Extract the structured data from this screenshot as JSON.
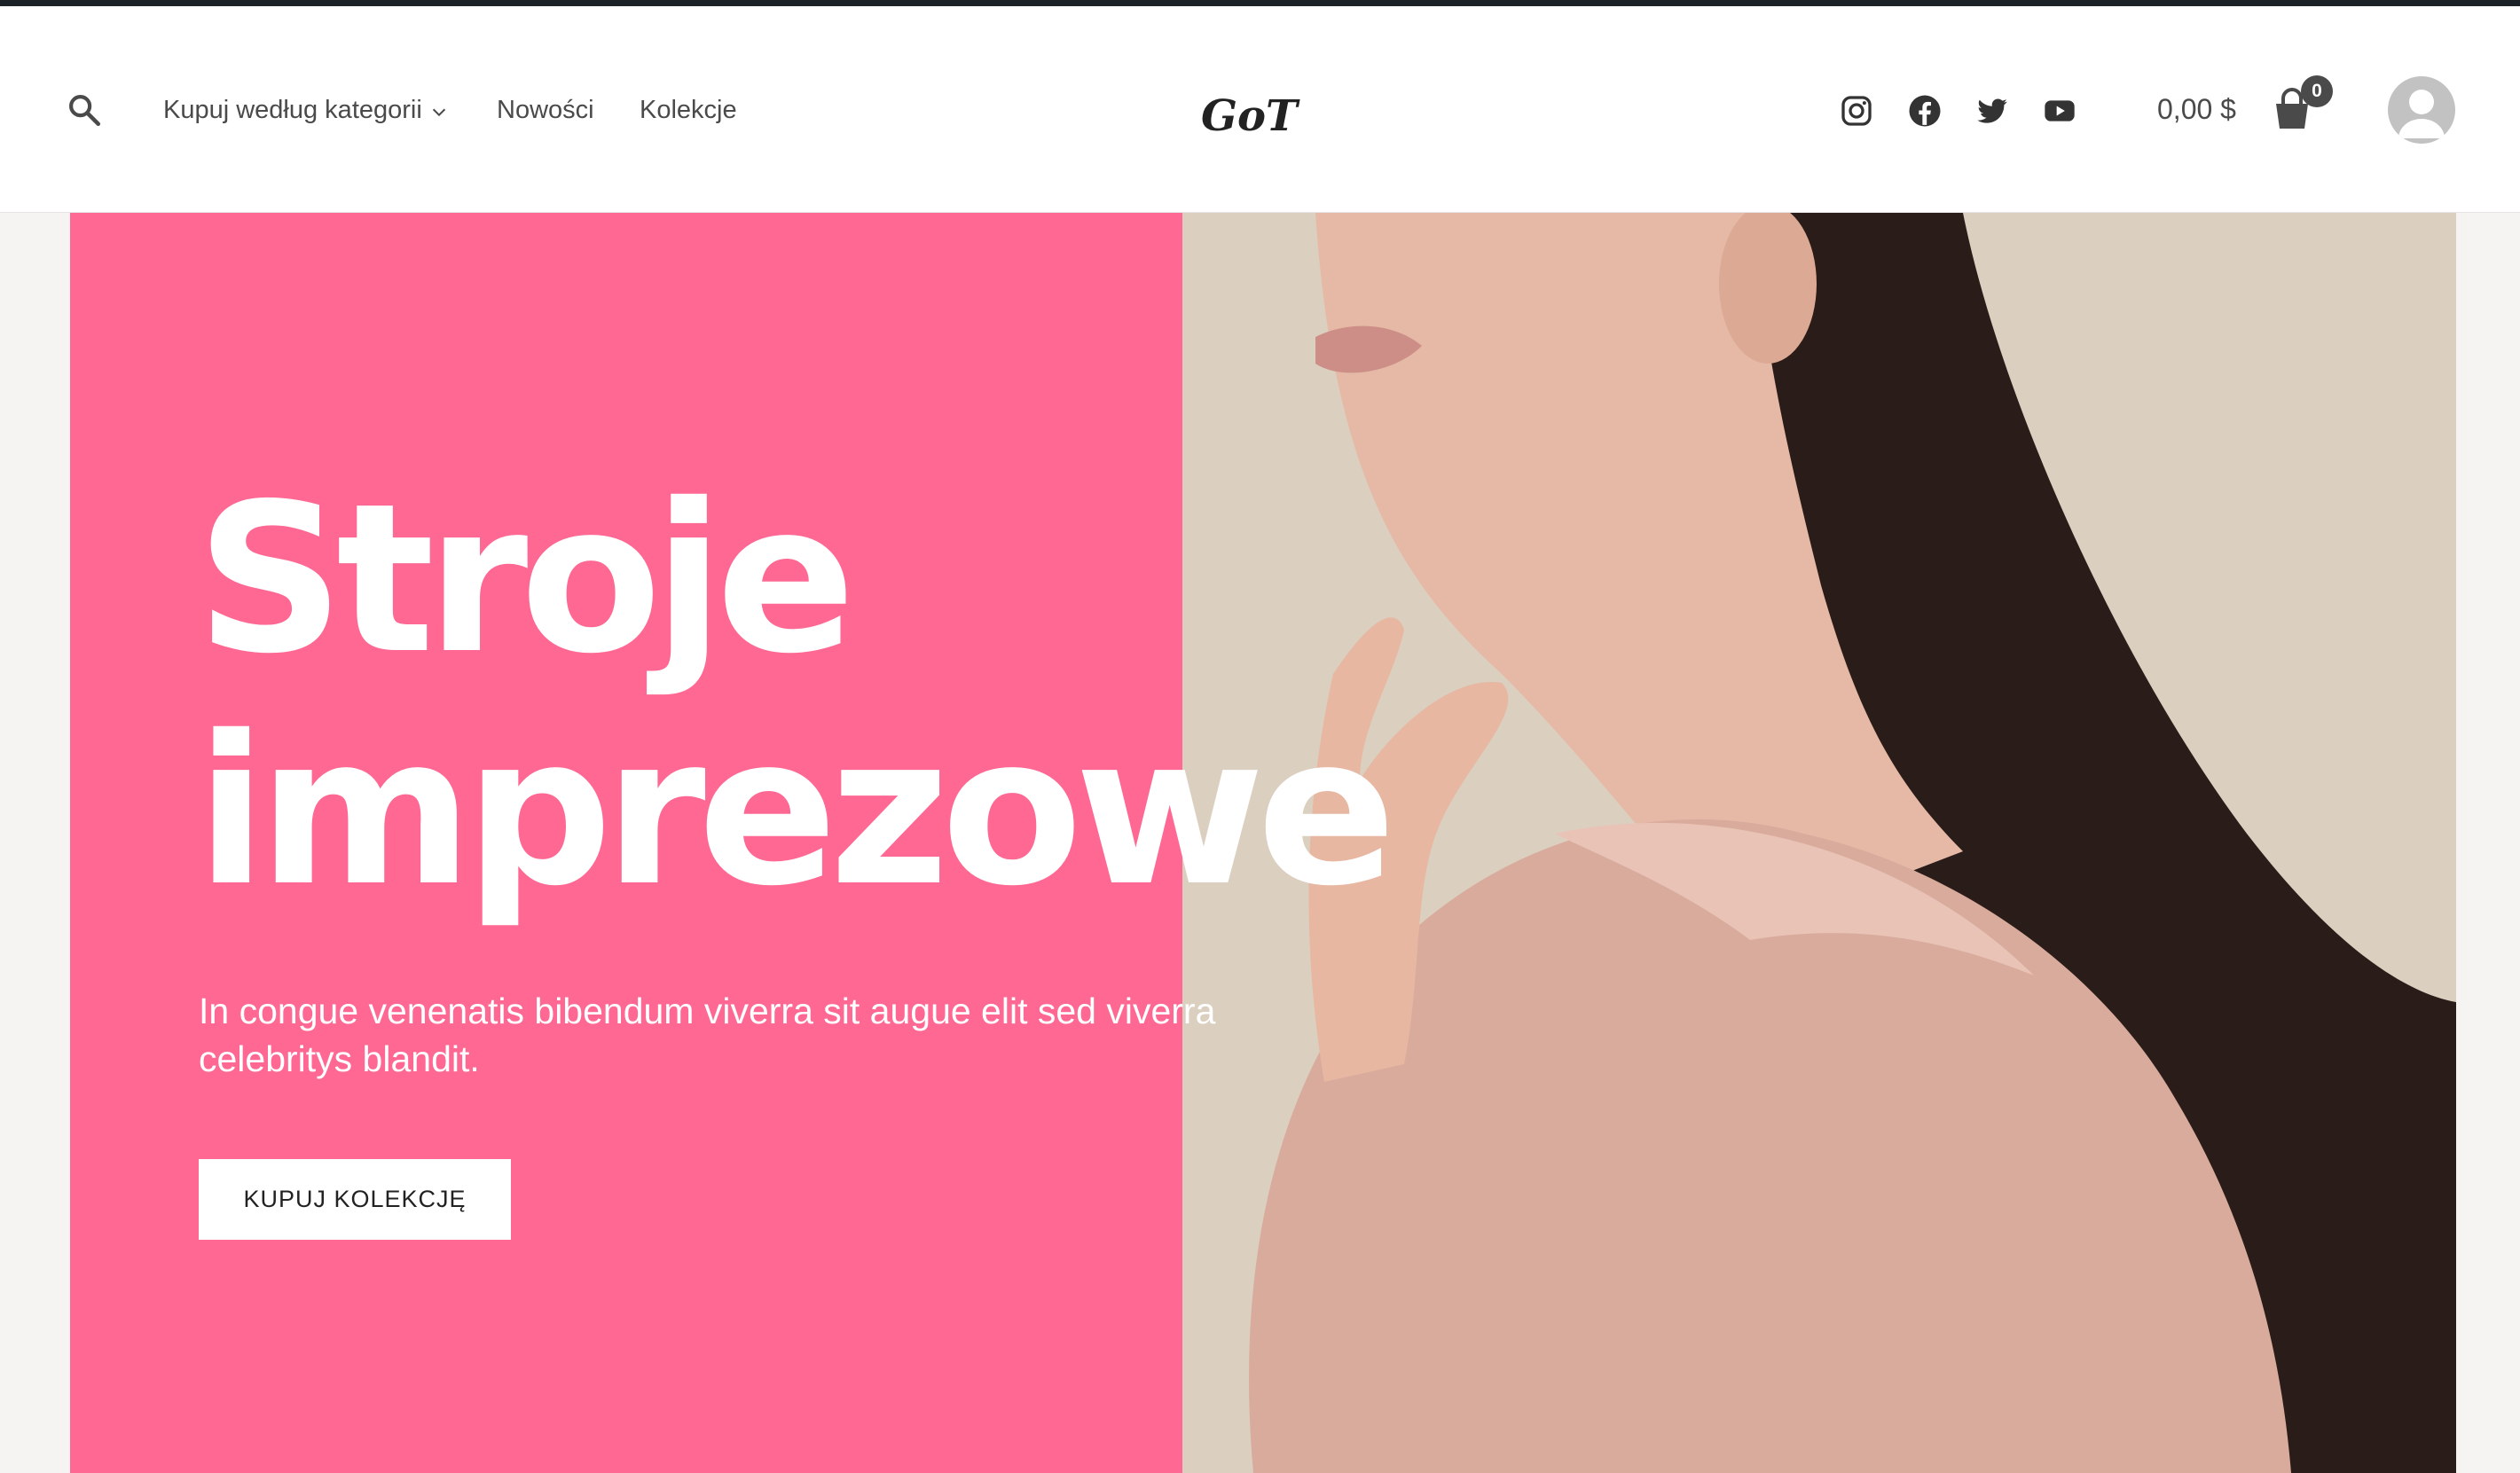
{
  "header": {
    "nav": {
      "categories_label": "Kupuj według kategorii",
      "new_label": "Nowości",
      "collections_label": "Kolekcje"
    },
    "logo_text": "GoT",
    "social": [
      "instagram-icon",
      "facebook-icon",
      "twitter-icon",
      "youtube-icon"
    ],
    "cart": {
      "total": "0,00 $",
      "count": "0"
    }
  },
  "hero": {
    "title": "Stroje\nimprezowe",
    "subtitle": "In congue venenatis bibendum viverra sit augue elit sed viverra celebritys blandit.",
    "button_label": "KUPUJ KOLEKCJĘ"
  },
  "colors": {
    "accent_pink": "#fe6893",
    "photo_bg": "#dbcfc0",
    "text": "#4a4a4a",
    "top_bar": "#1b2328"
  }
}
